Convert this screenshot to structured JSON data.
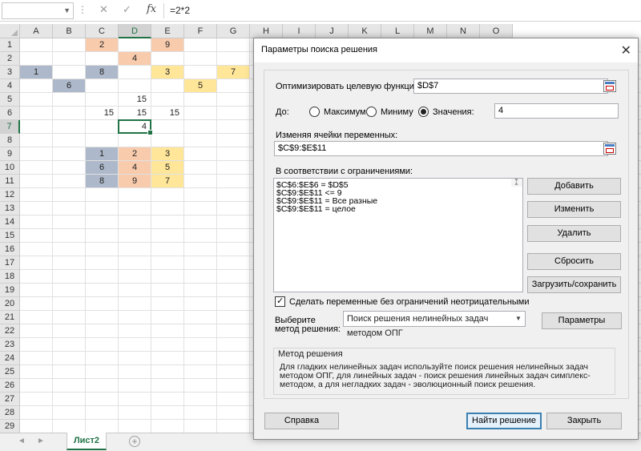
{
  "formula_bar": {
    "formula": "=2*2",
    "fx": "fx",
    "cancel_glyph": "✕",
    "enter_glyph": "✓"
  },
  "columns": [
    "A",
    "B",
    "C",
    "D",
    "E",
    "F",
    "G",
    "H",
    "I",
    "J",
    "K",
    "L",
    "M",
    "N",
    "O"
  ],
  "rows": [
    "1",
    "2",
    "3",
    "4",
    "5",
    "6",
    "7",
    "8",
    "9",
    "10",
    "11",
    "12",
    "13",
    "14",
    "15",
    "16",
    "17",
    "18",
    "19",
    "20",
    "21",
    "22",
    "23",
    "24",
    "25",
    "26",
    "27",
    "28",
    "29"
  ],
  "cells": [
    {
      "ref": "C1",
      "value": "2",
      "fill": "#f8cbad"
    },
    {
      "ref": "E1",
      "value": "9",
      "fill": "#f8cbad"
    },
    {
      "ref": "D2",
      "value": "4",
      "fill": "#f8cbad"
    },
    {
      "ref": "A3",
      "value": "1",
      "fill": "#adb9ca"
    },
    {
      "ref": "C3",
      "value": "8",
      "fill": "#adb9ca"
    },
    {
      "ref": "E3",
      "value": "3",
      "fill": "#ffe699"
    },
    {
      "ref": "G3",
      "value": "7",
      "fill": "#ffe699"
    },
    {
      "ref": "B4",
      "value": "6",
      "fill": "#adb9ca"
    },
    {
      "ref": "F4",
      "value": "5",
      "fill": "#ffe699"
    },
    {
      "ref": "D5",
      "value": "15",
      "fill": ""
    },
    {
      "ref": "C6",
      "value": "15",
      "fill": ""
    },
    {
      "ref": "D6",
      "value": "15",
      "fill": ""
    },
    {
      "ref": "E6",
      "value": "15",
      "fill": ""
    },
    {
      "ref": "D7",
      "value": "4",
      "fill": ""
    },
    {
      "ref": "C9",
      "value": "1",
      "fill": "#adb9ca"
    },
    {
      "ref": "D9",
      "value": "2",
      "fill": "#f8cbad"
    },
    {
      "ref": "E9",
      "value": "3",
      "fill": "#ffe699"
    },
    {
      "ref": "C10",
      "value": "6",
      "fill": "#adb9ca"
    },
    {
      "ref": "D10",
      "value": "4",
      "fill": "#f8cbad"
    },
    {
      "ref": "E10",
      "value": "5",
      "fill": "#ffe699"
    },
    {
      "ref": "C11",
      "value": "8",
      "fill": "#adb9ca"
    },
    {
      "ref": "D11",
      "value": "9",
      "fill": "#f8cbad"
    },
    {
      "ref": "E11",
      "value": "7",
      "fill": "#ffe699"
    }
  ],
  "active_cell": "D7",
  "sheet_tab": "Лист2",
  "dialog": {
    "title": "Параметры поиска решения",
    "objective_label": "Оптимизировать целевую функцию:",
    "objective_value": "$D$7",
    "to_label": "До:",
    "opt_max": "Максимум",
    "opt_min": "Миниму",
    "opt_value": "Значения:",
    "target_value": "4",
    "selected_option": "value",
    "vars_label": "Изменяя ячейки переменных:",
    "vars_value": "$C$9:$E$11",
    "constraints_label": "В соответствии с ограничениями:",
    "constraints": [
      "$C$6:$E$6 = $D$5",
      "$C$9:$E$11 <= 9",
      "$C$9:$E$11 = Все разные",
      "$C$9:$E$11 = целое"
    ],
    "btn_add": "Добавить",
    "btn_change": "Изменить",
    "btn_delete": "Удалить",
    "btn_reset": "Сбросить",
    "btn_load": "Загрузить/сохранить",
    "nonneg_label": "Сделать переменные без ограничений неотрицательными",
    "nonneg_checked": true,
    "method_label_1": "Выберите",
    "method_label_2": "метод решения:",
    "method_value": "Поиск решения нелинейных задач методом ОПГ",
    "btn_options": "Параметры",
    "group_title": "Метод решения",
    "description": "Для гладких нелинейных задач используйте поиск решения нелинейных задач методом ОПГ, для линейных задач - поиск решения линейных задач симплекс-методом, а для негладких задач - эволюционный поиск решения.",
    "btn_help": "Справка",
    "btn_solve": "Найти решение",
    "btn_close": "Закрыть"
  }
}
